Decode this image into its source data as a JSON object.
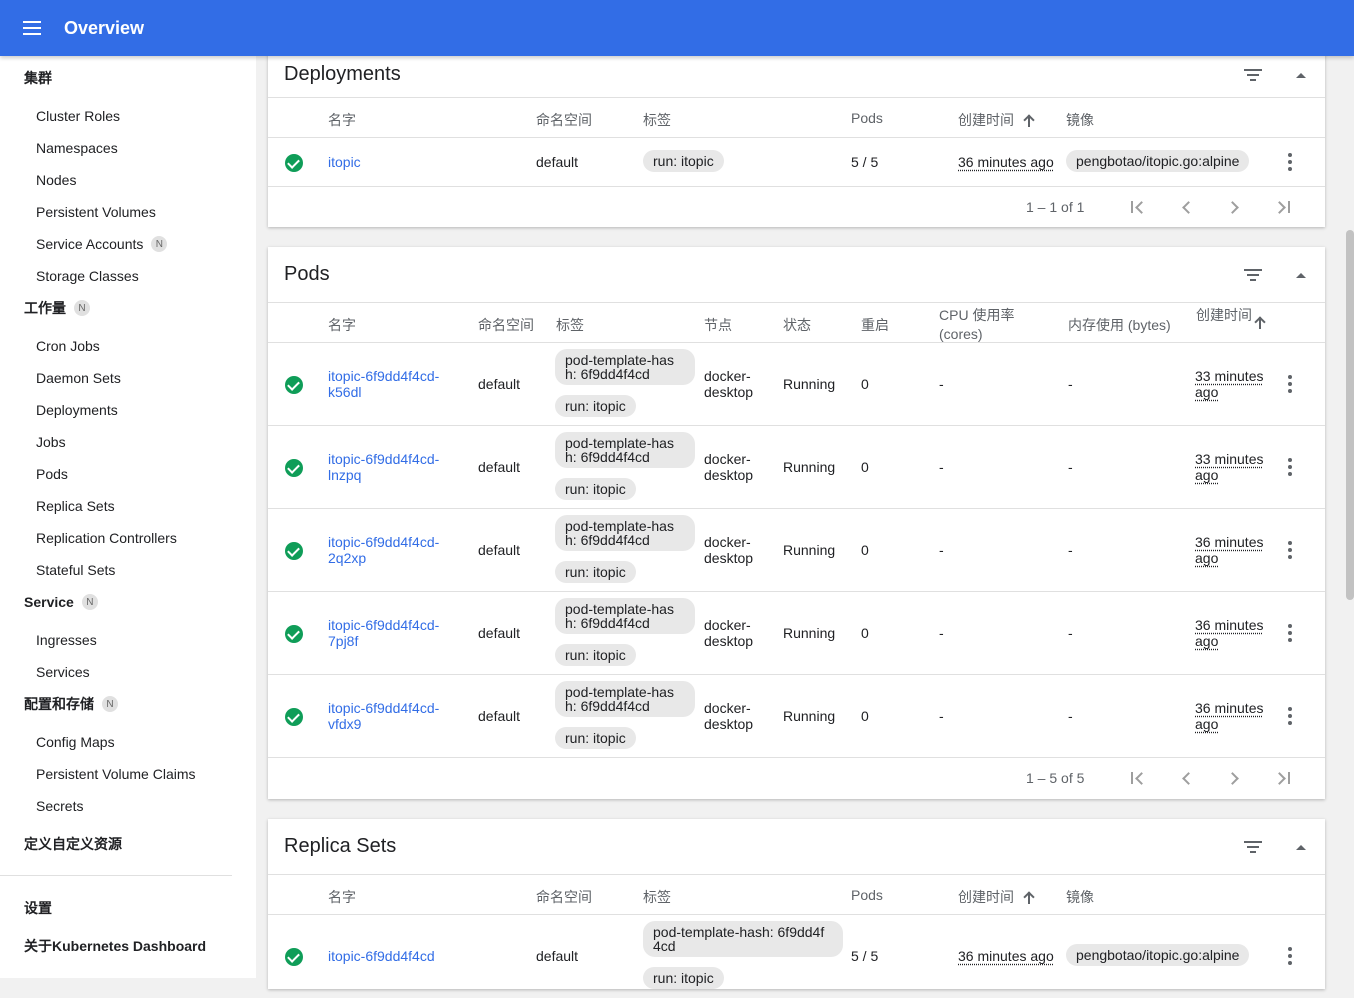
{
  "header": {
    "title": "Overview"
  },
  "sidebar": {
    "cluster": {
      "label": "集群",
      "items": [
        "Cluster Roles",
        "Namespaces",
        "Nodes",
        "Persistent Volumes",
        "Service Accounts",
        "Storage Classes"
      ]
    },
    "workloads": {
      "label": "工作量",
      "badge": "N",
      "items": [
        "Cron Jobs",
        "Daemon Sets",
        "Deployments",
        "Jobs",
        "Pods",
        "Replica Sets",
        "Replication Controllers",
        "Stateful Sets"
      ]
    },
    "service": {
      "label": "Service",
      "badge": "N",
      "items": [
        "Ingresses",
        "Services"
      ]
    },
    "config": {
      "label": "配置和存储",
      "badge": "N",
      "items": [
        "Config Maps",
        "Persistent Volume Claims",
        "Secrets"
      ]
    },
    "crd": {
      "label": "定义自定义资源"
    },
    "settings": {
      "label": "设置"
    },
    "about": {
      "label": "关于Kubernetes Dashboard"
    },
    "service_accounts_badge": "N"
  },
  "deployments": {
    "title": "Deployments",
    "headers": {
      "name": "名字",
      "namespace": "命名空间",
      "labels": "标签",
      "pods": "Pods",
      "created": "创建时间",
      "images": "镜像"
    },
    "rows": [
      {
        "name": "itopic",
        "namespace": "default",
        "labels": [
          "run: itopic"
        ],
        "pods": "5 / 5",
        "created": "36 minutes ago",
        "images": "pengbotao/itopic.go:alpine"
      }
    ],
    "pager": "1 – 1 of 1"
  },
  "pods": {
    "title": "Pods",
    "headers": {
      "name": "名字",
      "namespace": "命名空间",
      "labels": "标签",
      "node": "节点",
      "status": "状态",
      "restarts": "重启",
      "cpu": "CPU 使用率 (cores)",
      "memory": "内存使用 (bytes)",
      "created": "创建时间"
    },
    "rows": [
      {
        "name_l1": "itopic-6f9dd4f4cd-",
        "name_l2": "k56dl",
        "namespace": "default",
        "label_l1": "pod-template-has",
        "label_l2": "h: 6f9dd4f4cd",
        "label2": "run: itopic",
        "node_l1": "docker-",
        "node_l2": "desktop",
        "status": "Running",
        "restarts": "0",
        "cpu": "-",
        "memory": "-",
        "created_l1": "33 minutes",
        "created_l2": "ago"
      },
      {
        "name_l1": "itopic-6f9dd4f4cd-",
        "name_l2": "lnzpq",
        "namespace": "default",
        "label_l1": "pod-template-has",
        "label_l2": "h: 6f9dd4f4cd",
        "label2": "run: itopic",
        "node_l1": "docker-",
        "node_l2": "desktop",
        "status": "Running",
        "restarts": "0",
        "cpu": "-",
        "memory": "-",
        "created_l1": "33 minutes",
        "created_l2": "ago"
      },
      {
        "name_l1": "itopic-6f9dd4f4cd-",
        "name_l2": "2q2xp",
        "namespace": "default",
        "label_l1": "pod-template-has",
        "label_l2": "h: 6f9dd4f4cd",
        "label2": "run: itopic",
        "node_l1": "docker-",
        "node_l2": "desktop",
        "status": "Running",
        "restarts": "0",
        "cpu": "-",
        "memory": "-",
        "created_l1": "36 minutes",
        "created_l2": "ago"
      },
      {
        "name_l1": "itopic-6f9dd4f4cd-",
        "name_l2": "7pj8f",
        "namespace": "default",
        "label_l1": "pod-template-has",
        "label_l2": "h: 6f9dd4f4cd",
        "label2": "run: itopic",
        "node_l1": "docker-",
        "node_l2": "desktop",
        "status": "Running",
        "restarts": "0",
        "cpu": "-",
        "memory": "-",
        "created_l1": "36 minutes",
        "created_l2": "ago"
      },
      {
        "name_l1": "itopic-6f9dd4f4cd-",
        "name_l2": "vfdx9",
        "namespace": "default",
        "label_l1": "pod-template-has",
        "label_l2": "h: 6f9dd4f4cd",
        "label2": "run: itopic",
        "node_l1": "docker-",
        "node_l2": "desktop",
        "status": "Running",
        "restarts": "0",
        "cpu": "-",
        "memory": "-",
        "created_l1": "36 minutes",
        "created_l2": "ago"
      }
    ],
    "pager": "1 – 5 of 5"
  },
  "replicasets": {
    "title": "Replica Sets",
    "headers": {
      "name": "名字",
      "namespace": "命名空间",
      "labels": "标签",
      "pods": "Pods",
      "created": "创建时间",
      "images": "镜像"
    },
    "rows": [
      {
        "name": "itopic-6f9dd4f4cd",
        "namespace": "default",
        "label_l1": "pod-template-hash: 6f9dd4f",
        "label_l2": "4cd",
        "label2": "run: itopic",
        "pods": "5 / 5",
        "created": "36 minutes ago",
        "images": "pengbotao/itopic.go:alpine"
      }
    ]
  },
  "colors": {
    "primary": "#326de6",
    "success": "#0f9d58"
  }
}
